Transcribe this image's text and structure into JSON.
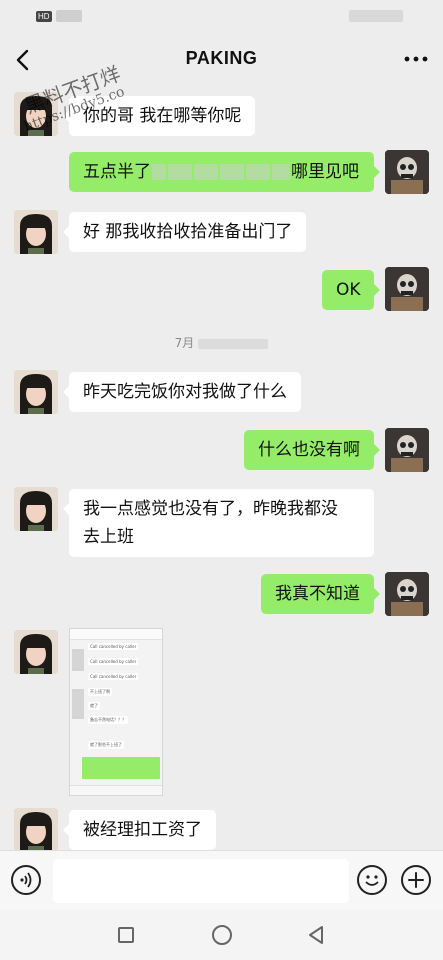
{
  "status_bar": {
    "hd": "HD"
  },
  "header": {
    "title": "PAKING"
  },
  "watermark": {
    "line1": "黑料不打烊",
    "line2": "https://bdy5.co"
  },
  "messages": [
    {
      "side": "left",
      "text": "你的哥 我在哪等你呢"
    },
    {
      "side": "right",
      "text_before": "五点半了",
      "text_after": "哪里见吧"
    },
    {
      "side": "left",
      "text": "好 那我收拾收拾准备出门了"
    },
    {
      "side": "right",
      "text": "OK"
    },
    {
      "side": "left",
      "text": "昨天吃完饭你对我做了什么"
    },
    {
      "side": "right",
      "text": "什么也没有啊"
    },
    {
      "side": "left",
      "text_line1": "我一点感觉也没有了，昨晚我都没",
      "text_line2": "去上班"
    },
    {
      "side": "right",
      "text": "我真不知道"
    },
    {
      "side": "left",
      "text": "被经理扣工资了"
    }
  ],
  "time_stamp": "7月",
  "screenshot_rows": [
    "Call cancelled by caller",
    "Call cancelled by caller",
    "Call cancelled by caller",
    "不上班了啊",
    "备忘不然电话？？？",
    "就了",
    "就了那些不上班了"
  ],
  "colors": {
    "bubble_right": "#95ec69",
    "bubble_left": "#ffffff",
    "background": "#ededed"
  }
}
